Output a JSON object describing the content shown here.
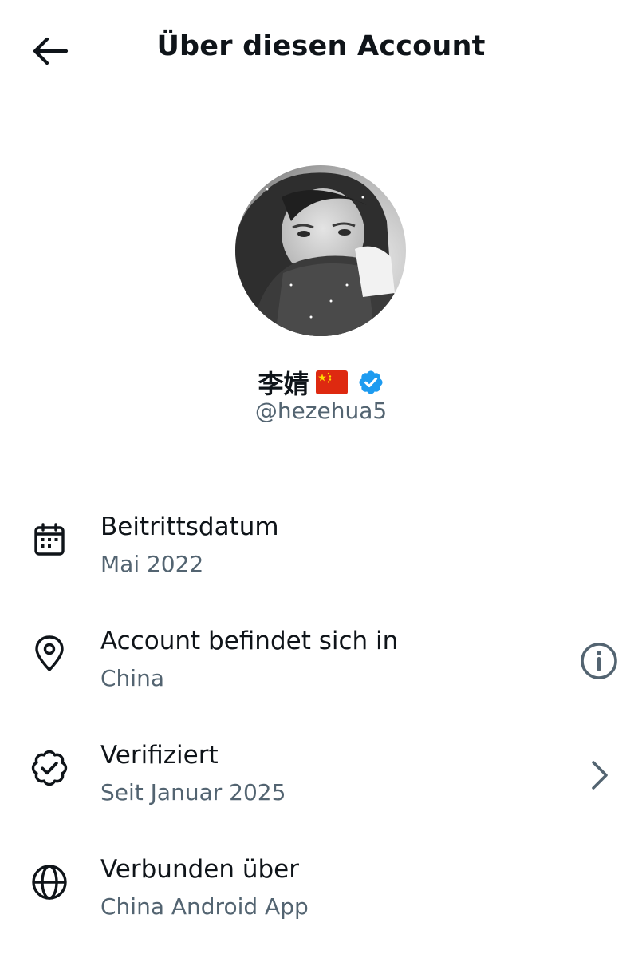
{
  "header": {
    "title": "Über diesen Account",
    "back_icon": "arrow-left-icon"
  },
  "profile": {
    "name": "李婧",
    "flag_icon": "china-flag-icon",
    "verified_icon": "verified-badge-icon",
    "verified_color": "#1d9bf0",
    "handle": "@hezehua5"
  },
  "items": [
    {
      "icon": "calendar-icon",
      "title": "Beitrittsdatum",
      "value": "Mai 2022"
    },
    {
      "icon": "location-pin-icon",
      "title": "Account befindet sich in",
      "value": "China",
      "action_icon": "info-circle-icon"
    },
    {
      "icon": "verified-outline-icon",
      "title": "Verifiziert",
      "value": "Seit Januar 2025",
      "action_icon": "chevron-right-icon"
    },
    {
      "icon": "globe-icon",
      "title": "Verbunden über",
      "value": "China Android App"
    }
  ],
  "colors": {
    "text_primary": "#0f1419",
    "text_secondary": "#536471",
    "background": "#ffffff"
  }
}
